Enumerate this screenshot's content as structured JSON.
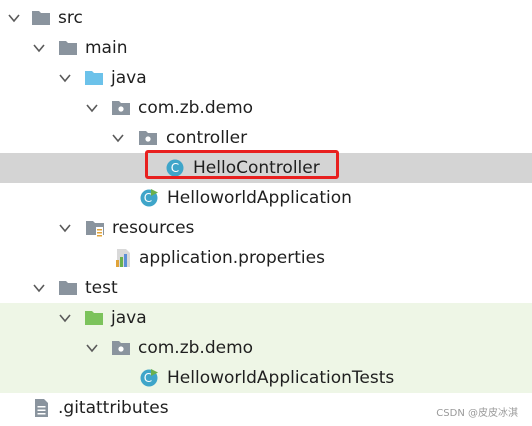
{
  "tree": {
    "src": "src",
    "main": "main",
    "main_java": "java",
    "main_pkg": "com.zb.demo",
    "controller": "controller",
    "hello_controller": "HelloController",
    "app": "HelloworldApplication",
    "resources": "resources",
    "properties": "application.properties",
    "test": "test",
    "test_java": "java",
    "test_pkg": "com.zb.demo",
    "app_tests": "HelloworldApplicationTests",
    "gitattributes": ".gitattributes"
  },
  "selected_item": "HelloController",
  "watermark": "CSDN @皮皮冰淇",
  "colors": {
    "selection": "#d4d4d4",
    "test_background": "#eef6e6",
    "highlight_border": "#e8201f",
    "folder": "#8a949e",
    "source_folder": "#6cc2ea",
    "test_folder": "#7cc35c",
    "class_icon": "#3fa5c9"
  }
}
